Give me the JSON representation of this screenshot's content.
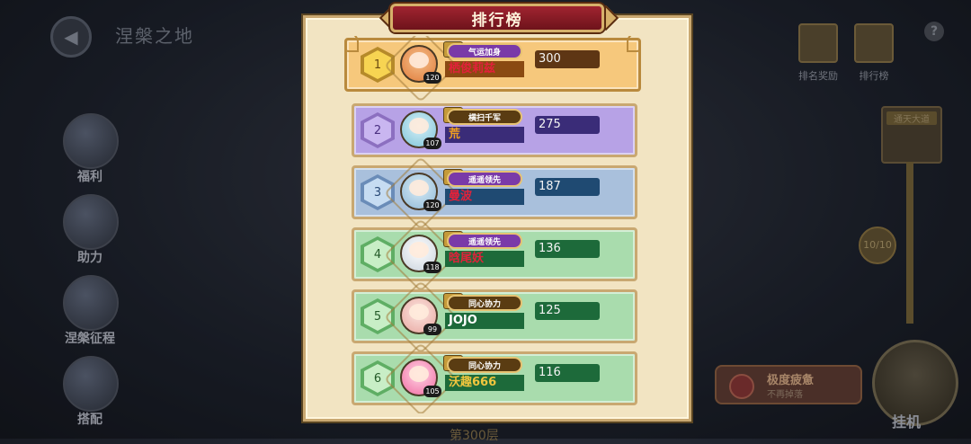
{
  "scene": {
    "title": "涅槃之地",
    "bottom_text": "第300层"
  },
  "left_menu": [
    {
      "label": "福利"
    },
    {
      "label": "助力"
    },
    {
      "label": "涅槃征程"
    },
    {
      "label": "搭配"
    }
  ],
  "top_right": {
    "rank_reward_label": "排名奖励",
    "ranking_label": "排行榜",
    "help_glyph": "?"
  },
  "side": {
    "tower_label": "通天大道",
    "progress": "10/10",
    "fatigue_title": "极度疲惫",
    "fatigue_sub": "不再掉落",
    "idle_label": "挂机"
  },
  "panel": {
    "title": "排行榜"
  },
  "ranking": [
    {
      "rank": "1",
      "level": "120",
      "badge": "气运加身",
      "name": "栖俊莉兹",
      "score": "300"
    },
    {
      "rank": "2",
      "level": "107",
      "badge": "横扫千军",
      "name": "荒",
      "score": "275"
    },
    {
      "rank": "3",
      "level": "120",
      "badge": "遥遥领先",
      "name": "曼波",
      "score": "187"
    },
    {
      "rank": "4",
      "level": "118",
      "badge": "遥遥领先",
      "name": "晗尾妖",
      "score": "136"
    },
    {
      "rank": "5",
      "level": "99",
      "badge": "同心协力",
      "name": "JOJO",
      "score": "125"
    },
    {
      "rank": "6",
      "level": "105",
      "badge": "同心协力",
      "name": "沃趣666",
      "score": "116"
    }
  ],
  "colors": {
    "row1_bg": "#f6c87c",
    "row2_bg": "#b7a2e6",
    "row3_bg": "#a9c0dc",
    "row_green_bg": "#a9dcad",
    "name_red": "#e2213a",
    "name_orange": "#f0a020",
    "name_white": "#ffffff",
    "name_gold": "#f2c63e"
  }
}
